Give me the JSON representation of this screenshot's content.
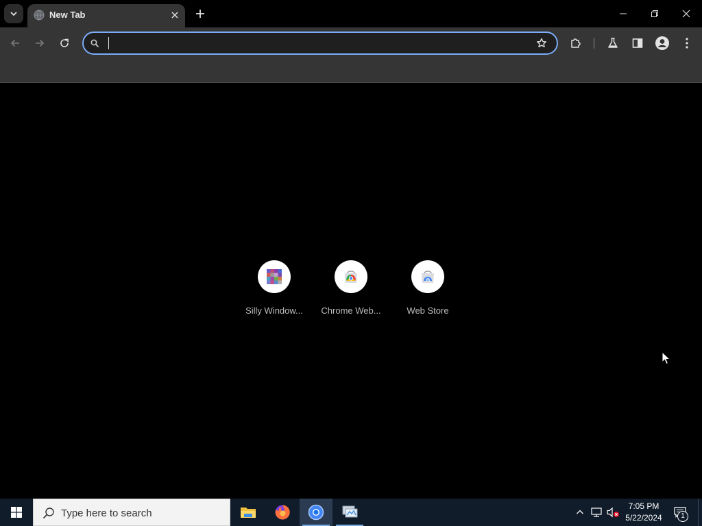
{
  "browser": {
    "tab": {
      "title": "New Tab"
    },
    "omnibox": {
      "value": "",
      "placeholder": ""
    },
    "colors": {
      "accent": "#7cacf8",
      "toolbar": "#353535",
      "frame": "#000000"
    }
  },
  "shortcuts": [
    {
      "label": "Silly Window...",
      "icon": "silly-window-icon"
    },
    {
      "label": "Chrome Web...",
      "icon": "chrome-web-store-icon"
    },
    {
      "label": "Web Store",
      "icon": "web-store-icon"
    }
  ],
  "taskbar": {
    "search_placeholder": "Type here to search",
    "apps": [
      "file-explorer",
      "firefox",
      "chrome",
      "network-app"
    ],
    "active_app": "chrome",
    "clock": {
      "time": "7:05 PM",
      "date": "5/22/2024"
    },
    "notification_count": "1"
  }
}
